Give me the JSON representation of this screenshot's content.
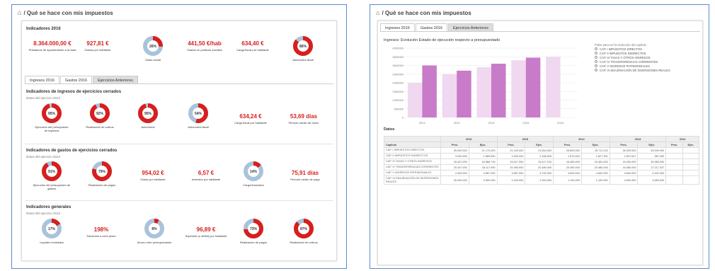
{
  "left": {
    "page_title": "/ Qué se hace con mis impuestos",
    "ind_title": "Indicadores 2016",
    "top_metrics": [
      {
        "value": "8.364.000,00 €",
        "label": "Préstamos de Ayuntamiento a la vista"
      },
      {
        "value": "927,81 €",
        "label": "Gastos por habitante"
      },
      {
        "value": "441,50 €/hab",
        "label": "Gastos en políticas sociales"
      },
      {
        "value": "634,40 €",
        "label": "Carga fiscal por habitante"
      }
    ],
    "top_donuts": [
      {
        "pct": "26%",
        "label": "Gasto social",
        "value": 26
      },
      {
        "pct": "86%",
        "label": "Autonomía fiscal",
        "value": 86
      }
    ],
    "tabs": [
      "Ingresos 2016",
      "Gastos 2016",
      "Ejercicios Anteriores"
    ],
    "sec1": {
      "title": "Indicadores de ingresos de ejercicios cerrados",
      "sub": "Datos del ejercicio 2013",
      "donuts": [
        {
          "pct": "95%",
          "label": "Ejecución del presupuesto de ingresos",
          "value": 95
        },
        {
          "pct": "92%",
          "label": "Realización de cobros",
          "value": 92
        },
        {
          "pct": "95%",
          "label": "Autonomía",
          "value": 95
        },
        {
          "pct": "54%",
          "label": "Autonomía fiscal",
          "value": 54
        }
      ],
      "metrics": [
        {
          "value": "634,24 €",
          "label": "Carga fiscal por habitante"
        },
        {
          "value": "53,69 días",
          "label": "Período medio de cobro"
        }
      ]
    },
    "sec2": {
      "title": "Indicadores de gastos de ejercicios cerrados",
      "sub": "Datos del ejercicio 2013",
      "donuts": [
        {
          "pct": "91%",
          "label": "Ejecución del presupuesto de gastos",
          "value": 91
        },
        {
          "pct": "79%",
          "label": "Realización de pagos",
          "value": 79
        },
        {
          "pct": "14%",
          "label": "Carga financiera",
          "value": 14
        }
      ],
      "metrics": [
        {
          "value": "954,02 €",
          "label": "Gasto por habitante"
        },
        {
          "value": "6,57 €",
          "label": "Inversión por habitante"
        },
        {
          "value": "75,91 días",
          "label": "Período medio de pago"
        }
      ]
    },
    "sec3": {
      "title": "Indicadores generales",
      "sub": "Datos del ejercicio 2013",
      "donuts": [
        {
          "pct": "17%",
          "label": "Liquidez inmediata",
          "value": 17
        },
        {
          "pct": "8%",
          "label": "Ahorro neto presupuestario",
          "value": 8
        },
        {
          "pct": "73%",
          "label": "Realización de pagos",
          "value": 73
        },
        {
          "pct": "87%",
          "label": "Realización de cobros",
          "value": 87
        }
      ],
      "metrics": [
        {
          "value": "198%",
          "label": "Solvencia a corto plazo"
        },
        {
          "value": "96,89 €",
          "label": "Superávit (o déficit) por habitante"
        }
      ]
    }
  },
  "right": {
    "page_title": "/ Qué se hace con mis impuestos",
    "tabs": [
      "Ingresos 2016",
      "Gastos 2016",
      "Ejercicios Anteriores"
    ],
    "chart_title": "Ingresos: Evolución Estado de ejecución respecto a presupuestado",
    "chart_data": {
      "type": "bar",
      "categories": [
        "2012",
        "2013",
        "2014",
        "2015",
        "2016"
      ],
      "series": [
        {
          "name": "Presupuesto",
          "values": [
            2000000,
            2500000,
            2900000,
            3300000,
            3500000
          ]
        },
        {
          "name": "Ejecutado",
          "values": [
            3000000,
            2700000,
            3100000,
            3450000,
            0
          ]
        }
      ],
      "ylim": [
        0,
        4000000
      ],
      "yticks": [
        "4000000",
        "3500000",
        "3000000",
        "2500000",
        "2000000",
        "1500000",
        "1000000",
        "500000",
        "0"
      ]
    },
    "legend_title": "Pulse para ver la evolución del capítulo",
    "legend": [
      "CAP. I IMPUESTOS DIRECTOS",
      "CAP. II IMPUESTOS INDIRECTOS",
      "CAP. III TASAS Y OTROS INGRESOS",
      "CAP. IV TRANSFERENCIAS CORRIENTES",
      "CAP. V INGRESOS PATRIMONIALES",
      "CAP. VI ENAJENACIÓN DE INVERSIONES REALES"
    ],
    "colors": {
      "pres": "#f0d8f0",
      "ejec": "#c87bc8"
    },
    "table_title": "Datos",
    "years": [
      "2016",
      "2015",
      "2014",
      "2013",
      "2012"
    ],
    "col_pres": "Pres.",
    "col_ejec": "Ejec.",
    "col_label": "Capítulo",
    "rows": [
      {
        "label": "CAP. I IMPUESTOS DIRECTOS",
        "v": [
          "26.000.000",
          "21.170.000",
          "21.100.000",
          "21.554.000",
          "25.800.000",
          "25.711.215",
          "26.000.000",
          "25.990.000",
          "",
          ""
        ]
      },
      {
        "label": "CAP. II IMPUESTOS INDIRECTOS",
        "v": [
          "3.000.000",
          "1.669.500",
          "2.000.000",
          "2.168.525",
          "1.670.000",
          "1.627.301",
          "1.627.647",
          "987.000",
          "",
          ""
        ]
      },
      {
        "label": "CAP. III TASAS Y OTROS INGRESOS",
        "v": [
          "16.447.000",
          "16.568.716",
          "16.417.000",
          "16.417.100",
          "16.480.000",
          "16.481.000",
          "16.400.000",
          "16.380.000",
          "",
          ""
        ]
      },
      {
        "label": "CAP. IV TRANSFERENCIAS CORRIENTES",
        "v": [
          "20.167.000",
          "18.117.900",
          "20.450.000",
          "20.480.000",
          "20.450.000",
          "20.480.000",
          "16.480.000",
          "17.217.437",
          "",
          ""
        ]
      },
      {
        "label": "CAP. V INGRESOS PATRIMONIALES",
        "v": [
          "4.400.000",
          "3.567.000",
          "3.867.000",
          "3.700.000",
          "4.600.000",
          "4.600.000",
          "4.600.000",
          "4.402.000",
          "",
          ""
        ]
      },
      {
        "label": "CAP. VI ENAJENACIÓN DE INVERSIONES REALES",
        "v": [
          "30.000.000",
          "3.500.000",
          "2.150.000",
          "1.900.000",
          "1.100.000",
          "1.100.000",
          "3.500.000",
          "3.460.000",
          "",
          ""
        ]
      }
    ]
  }
}
